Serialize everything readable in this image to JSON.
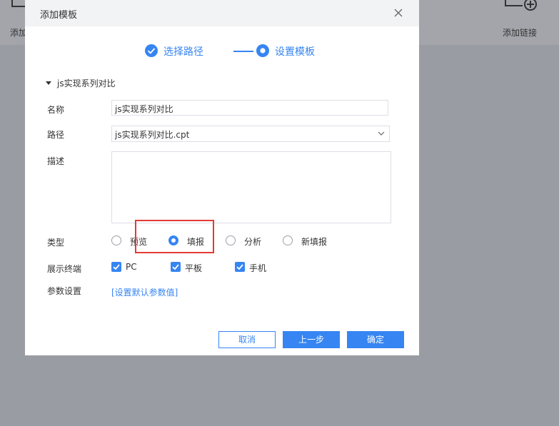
{
  "background": {
    "left_label": "添加",
    "right_label": "添加链接"
  },
  "dialog": {
    "title": "添加模板",
    "steps": [
      {
        "label": "选择路径",
        "state": "done"
      },
      {
        "label": "设置模板",
        "state": "active"
      }
    ],
    "group_title": "js实现系列对比",
    "fields": {
      "name_label": "名称",
      "name_value": "js实现系列对比",
      "path_label": "路径",
      "path_value": "js实现系列对比.cpt",
      "desc_label": "描述",
      "desc_value": "",
      "type_label": "类型",
      "type_options": [
        "预览",
        "填报",
        "分析",
        "新填报"
      ],
      "type_selected": "填报",
      "terminal_label": "展示终端",
      "terminal_options": [
        {
          "label": "PC",
          "checked": true
        },
        {
          "label": "平板",
          "checked": true
        },
        {
          "label": "手机",
          "checked": true
        }
      ],
      "param_label": "参数设置",
      "param_link": "[设置默认参数值]"
    },
    "buttons": {
      "cancel": "取消",
      "prev": "上一步",
      "ok": "确定"
    }
  },
  "colors": {
    "accent": "#3685f2",
    "highlight": "#e53935",
    "overlay": "#9a9ca3"
  }
}
